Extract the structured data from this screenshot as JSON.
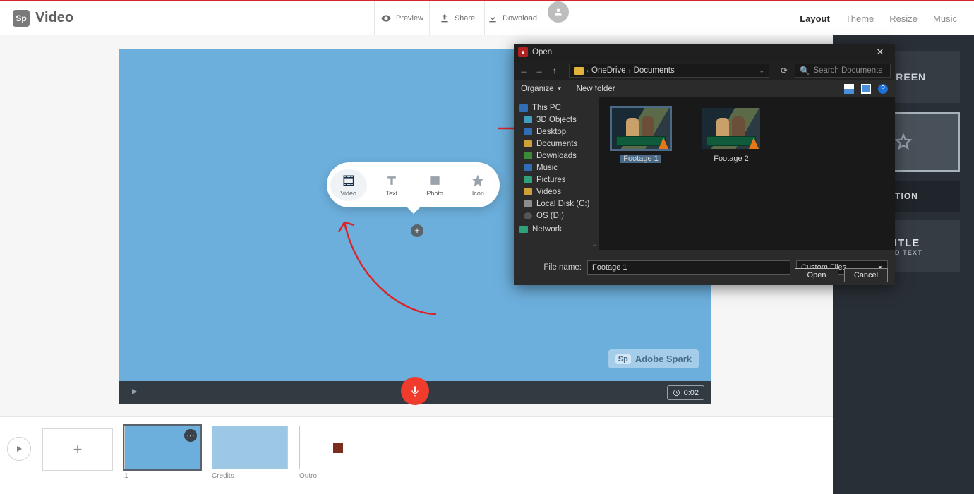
{
  "logo": {
    "badge": "Sp",
    "text": "Video"
  },
  "topActions": {
    "preview": "Preview",
    "share": "Share",
    "download": "Download"
  },
  "rightTabs": {
    "layout": "Layout",
    "theme": "Theme",
    "resize": "Resize",
    "music": "Music"
  },
  "popover": {
    "video": "Video",
    "text": "Text",
    "photo": "Photo",
    "icon": "Icon"
  },
  "canvas": {
    "watermark_brand": "Sp",
    "watermark_text": "Adobe Spark",
    "time": "0:02"
  },
  "sidebar": {
    "screen": "SCREEN",
    "caption": "PTION",
    "title_t1": "TITLE",
    "title_t2": "AND TEXT"
  },
  "timeline": {
    "slide1_label": "1",
    "slide2_label": "Credits",
    "slide3_label": "Outro"
  },
  "dialog": {
    "title": "Open",
    "breadcrumb": {
      "a": "OneDrive",
      "b": "Documents"
    },
    "search_placeholder": "Search Documents",
    "toolbar": {
      "organize": "Organize",
      "newfolder": "New folder"
    },
    "tree": {
      "thispc": "This PC",
      "objects3d": "3D Objects",
      "desktop": "Desktop",
      "documents": "Documents",
      "downloads": "Downloads",
      "music": "Music",
      "pictures": "Pictures",
      "videos": "Videos",
      "localdisk": "Local Disk (C:)",
      "osd": "OS (D:)",
      "network": "Network"
    },
    "files": {
      "f1": "Footage 1",
      "f2": "Footage 2"
    },
    "filename_label": "File name:",
    "filename_value": "Footage 1",
    "filetype": "Custom Files",
    "open_btn": "Open",
    "cancel_btn": "Cancel"
  }
}
